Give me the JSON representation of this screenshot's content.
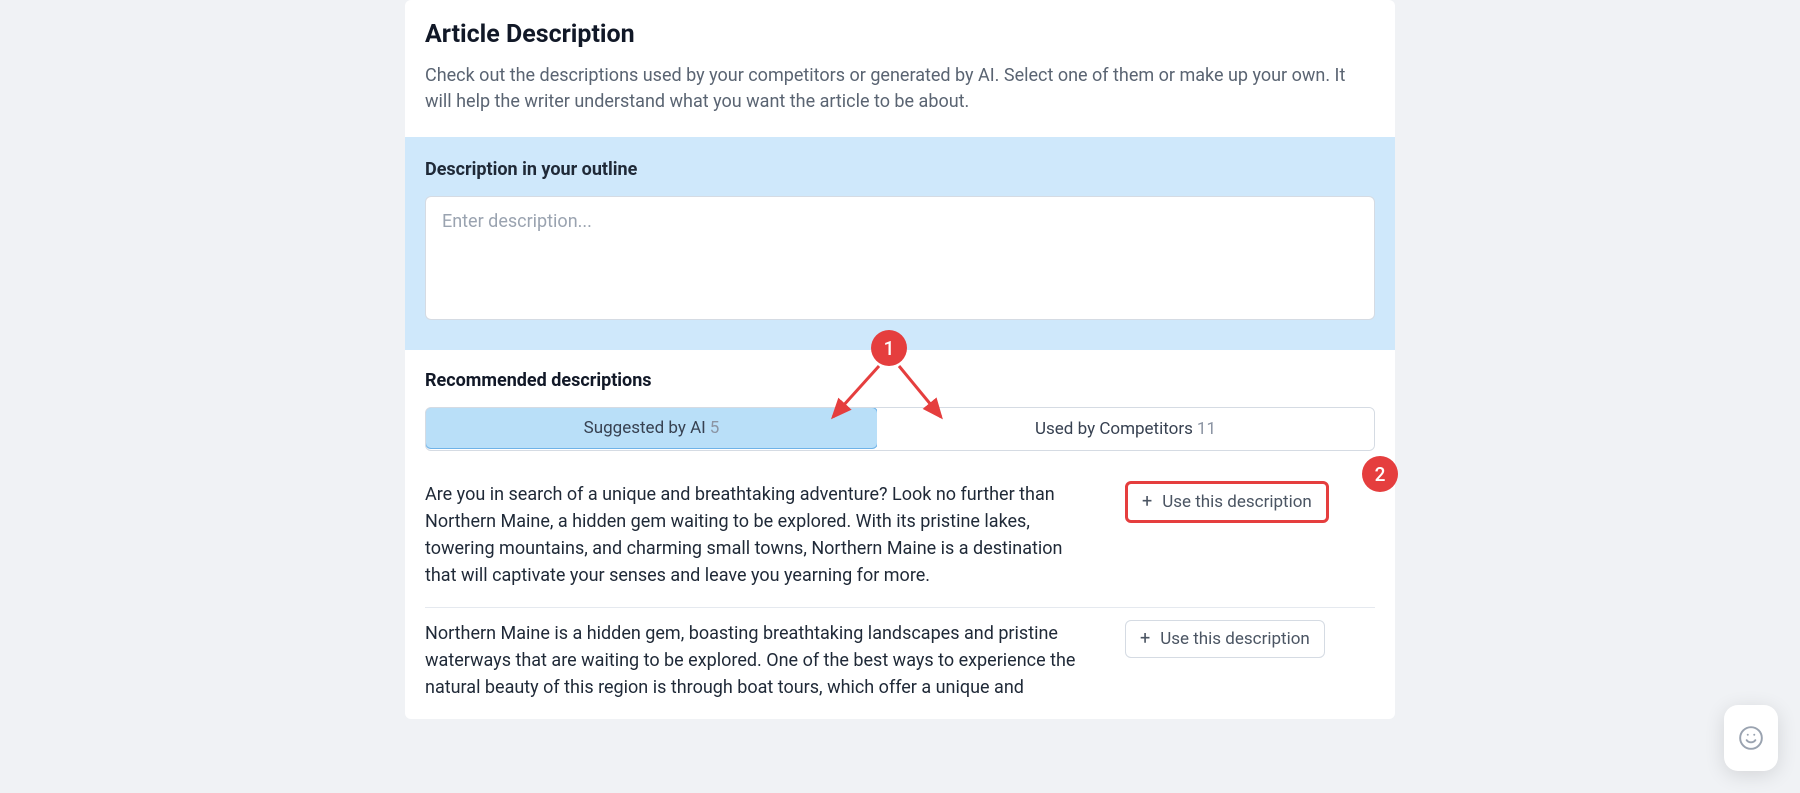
{
  "header": {
    "title": "Article Description",
    "subtitle": "Check out the descriptions used by your competitors or generated by AI. Select one of them or make up your own. It will help the writer understand what you want the article to be about."
  },
  "outline": {
    "label": "Description in your outline",
    "placeholder": "Enter description...",
    "value": ""
  },
  "recommended": {
    "title": "Recommended descriptions",
    "tabs": [
      {
        "label": "Suggested by AI",
        "count": "5",
        "active": true
      },
      {
        "label": "Used by Competitors",
        "count": "11",
        "active": false
      }
    ],
    "use_label": "Use this description",
    "items": [
      {
        "text": "Are you in search of a unique and breathtaking adventure? Look no further than Northern Maine, a hidden gem waiting to be explored. With its pristine lakes, towering mountains, and charming small towns, Northern Maine is a destination that will captivate your senses and leave you yearning for more."
      },
      {
        "text": "Northern Maine is a hidden gem, boasting breathtaking landscapes and pristine waterways that are waiting to be explored. One of the best ways to experience the natural beauty of this region is through boat tours, which offer a unique and"
      }
    ]
  },
  "annotations": {
    "badge1": "1",
    "badge2": "2"
  }
}
